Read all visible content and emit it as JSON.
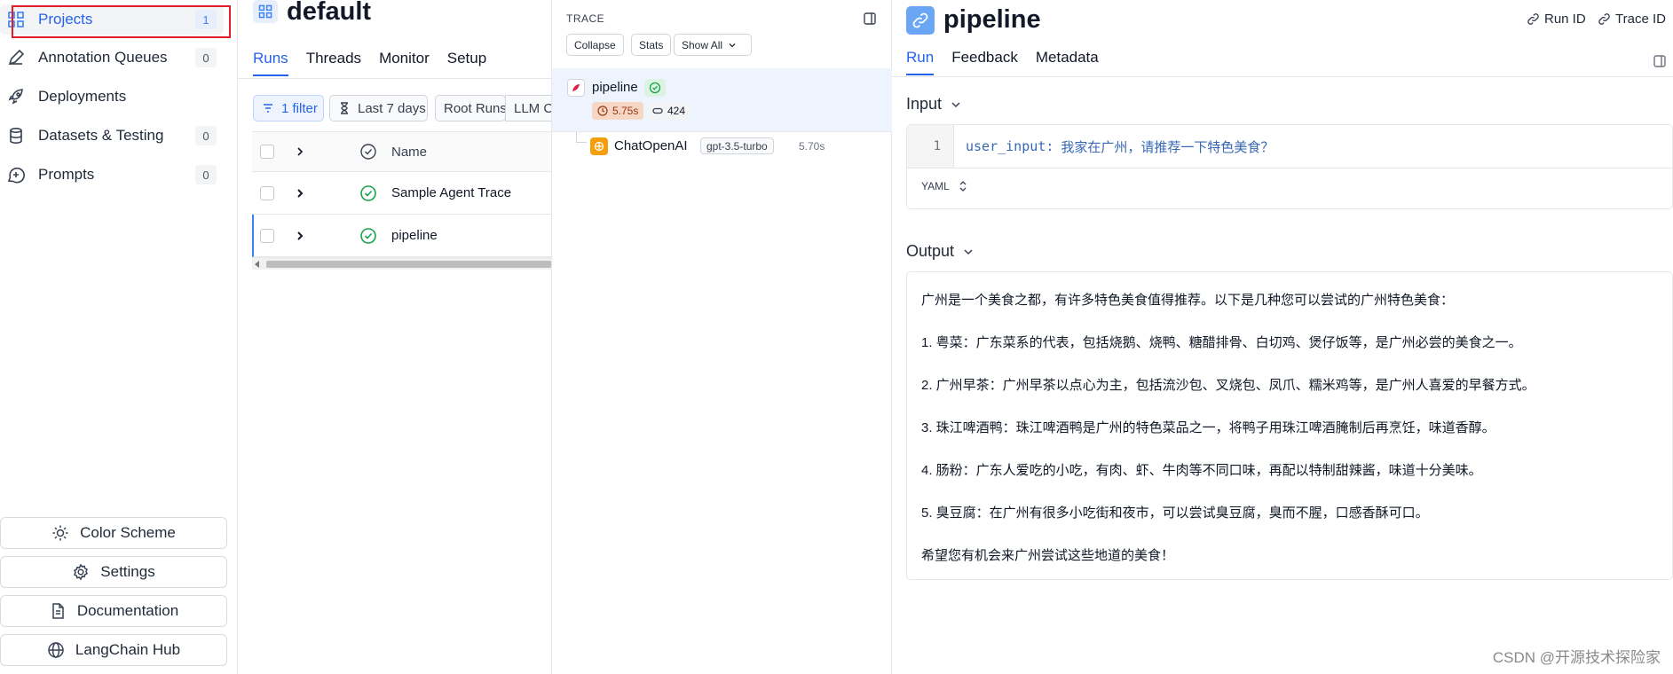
{
  "sidebar": {
    "items": [
      {
        "label": "Projects",
        "count": "1",
        "icon": "grid-icon"
      },
      {
        "label": "Annotation Queues",
        "count": "0",
        "icon": "pen-icon"
      },
      {
        "label": "Deployments",
        "count": "",
        "icon": "rocket-icon"
      },
      {
        "label": "Datasets & Testing",
        "count": "0",
        "icon": "database-icon"
      },
      {
        "label": "Prompts",
        "count": "0",
        "icon": "chat-plus-icon"
      }
    ],
    "bottom": [
      {
        "label": "Color Scheme",
        "icon": "sun-icon"
      },
      {
        "label": "Settings",
        "icon": "gear-icon"
      },
      {
        "label": "Documentation",
        "icon": "document-icon"
      },
      {
        "label": "LangChain Hub",
        "icon": "globe-icon"
      }
    ]
  },
  "runs": {
    "project_title": "default",
    "tabs": [
      "Runs",
      "Threads",
      "Monitor",
      "Setup"
    ],
    "filters": {
      "filter": "1 filter",
      "range": "Last 7 days",
      "root": "Root Runs",
      "llm": "LLM Calls"
    },
    "column_name": "Name",
    "rows": [
      "Sample Agent Trace",
      "pipeline"
    ]
  },
  "trace": {
    "label": "TRACE",
    "buttons": {
      "collapse": "Collapse",
      "stats": "Stats",
      "show_all": "Show All"
    },
    "root": {
      "name": "pipeline",
      "latency": "5.75s",
      "tokens": "424"
    },
    "child": {
      "name": "ChatOpenAI",
      "model": "gpt-3.5-turbo",
      "latency": "5.70s"
    }
  },
  "detail": {
    "title": "pipeline",
    "run_id_label": "Run ID",
    "trace_id_label": "Trace ID",
    "tabs": [
      "Run",
      "Feedback",
      "Metadata"
    ],
    "input_title": "Input",
    "input_line_number": "1",
    "input_key": "user_input",
    "input_value": "我家在广州，请推荐一下特色美食？",
    "format_label": "YAML",
    "output_title": "Output",
    "output_lines": [
      "广州是一个美食之都，有许多特色美食值得推荐。以下是几种您可以尝试的广州特色美食：",
      "1. 粤菜：广东菜系的代表，包括烧鹅、烧鸭、糖醋排骨、白切鸡、煲仔饭等，是广州必尝的美食之一。",
      "2. 广州早茶：广州早茶以点心为主，包括流沙包、叉烧包、凤爪、糯米鸡等，是广州人喜爱的早餐方式。",
      "3. 珠江啤酒鸭：珠江啤酒鸭是广州的特色菜品之一，将鸭子用珠江啤酒腌制后再烹饪，味道香醇。",
      "4. 肠粉：广东人爱吃的小吃，有肉、虾、牛肉等不同口味，再配以特制甜辣酱，味道十分美味。",
      "5. 臭豆腐：在广州有很多小吃街和夜市，可以尝试臭豆腐，臭而不腥，口感香酥可口。",
      "希望您有机会来广州尝试这些地道的美食！"
    ]
  },
  "watermark": "CSDN @开源技术探险家",
  "colors": {
    "accent": "#2563eb",
    "highlight_box": "#e11d2a",
    "success": "#16a34a",
    "latency_bg": "#f6d7c4",
    "chatopenai_icon": "#f59e0b"
  }
}
